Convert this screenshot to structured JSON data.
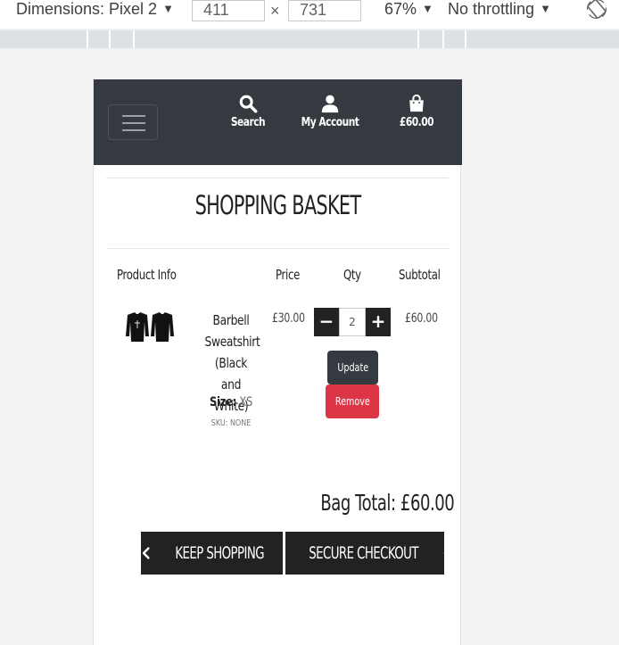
{
  "devtools": {
    "dimensions_label": "Dimensions: Pixel 2",
    "width_value": "411",
    "height_value": "731",
    "times": "×",
    "zoom": "67%",
    "throttling": "No throttling",
    "dropdown_arrow": "▼"
  },
  "nav": {
    "search_label": "Search",
    "account_label": "My Account",
    "bag_total": "£60.00",
    "icons": [
      "menu-icon",
      "search-icon",
      "user-icon",
      "shopping-bag-icon"
    ]
  },
  "page": {
    "title": "SHOPPING BASKET"
  },
  "table": {
    "headers": [
      "Product Info",
      "Price",
      "Qty",
      "Subtotal"
    ]
  },
  "item": {
    "name": "Barbell Sweatshirt (Black and White)",
    "size_label": "Size:",
    "size_value": "XS",
    "sku": "SKU: NONE",
    "price": "£30.00",
    "qty": "2",
    "minus": "−",
    "plus": "+",
    "subtotal": "£60.00",
    "update_label": "Update",
    "remove_label": "Remove"
  },
  "summary": {
    "bag_total": "Bag Total: £60.00",
    "keep_shopping_label": "KEEP SHOPPING",
    "checkout_label": "SECURE CHECKOUT"
  },
  "colors": {
    "navbar": "#343a40",
    "button_dark": "#222222",
    "remove": "#dc3545"
  }
}
